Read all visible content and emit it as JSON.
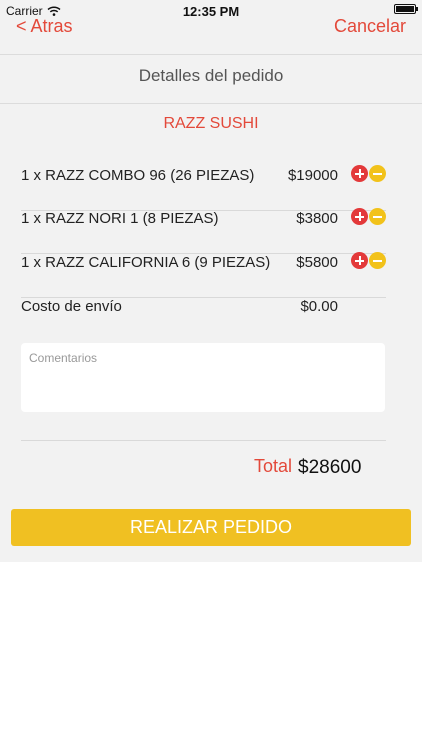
{
  "status_bar": {
    "carrier": "Carrier",
    "time": "12:35 PM"
  },
  "nav": {
    "back_label": "< Atras",
    "cancel_label": "Cancelar"
  },
  "page": {
    "title": "Detalles del pedido",
    "restaurant": "RAZZ SUSHI"
  },
  "items": [
    {
      "description": "1 x RAZZ COMBO 96 (26 PIEZAS)",
      "price": "$19000"
    },
    {
      "description": "1 x RAZZ NORI 1 (8 PIEZAS)",
      "price": "$3800"
    },
    {
      "description": "1 x RAZZ CALIFORNIA 6 (9 PIEZAS)",
      "price": "$5800"
    }
  ],
  "shipping": {
    "label": "Costo de envío",
    "price": "$0.00"
  },
  "comments": {
    "placeholder": "Comentarios"
  },
  "total": {
    "label": "Total",
    "value": "$28600"
  },
  "cta": {
    "label": "REALIZAR PEDIDO"
  },
  "colors": {
    "accent": "#e3493a",
    "button": "#f0c022",
    "minus_icon": "#f2c21a",
    "background": "#f2f2f2"
  }
}
